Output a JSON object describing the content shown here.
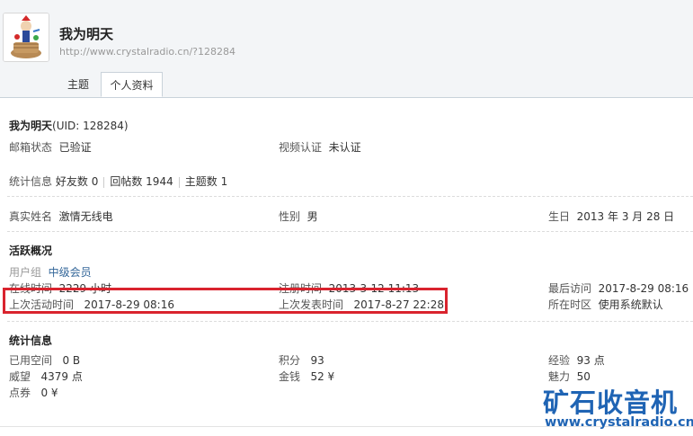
{
  "user": {
    "name": "我为明天",
    "url": "http://www.crystalradio.cn/?128284"
  },
  "tabs": [
    {
      "label": "主题",
      "active": false
    },
    {
      "label": "个人资料",
      "active": true
    }
  ],
  "profile": {
    "name": "我为明天",
    "uid_text": "(UID: 128284)",
    "email_status_label": "邮箱状态",
    "email_status_value": "已验证",
    "video_auth_label": "视频认证",
    "video_auth_value": "未认证",
    "stats_label": "统计信息",
    "friends_label": "好友数",
    "friends_value": "0",
    "replies_label": "回帖数",
    "replies_value": "1944",
    "topics_label": "主题数",
    "topics_value": "1",
    "realname_label": "真实姓名",
    "realname_value": "激情无线电",
    "gender_label": "性别",
    "gender_value": "男",
    "birthday_label": "生日",
    "birthday_value": "2013 年 3 月 28 日"
  },
  "activity": {
    "title": "活跃概况",
    "group_label": "用户组",
    "group_value": "中级会员",
    "online_label": "在线时间",
    "online_value": "2229 小时",
    "register_label": "注册时间",
    "register_value": "2013-3-12 11:13",
    "last_visit_label": "最后访问",
    "last_visit_value": "2017-8-29 08:16",
    "last_active_label": "上次活动时间",
    "last_active_value": "2017-8-29 08:16",
    "last_post_label": "上次发表时间",
    "last_post_value": "2017-8-27 22:28",
    "timezone_label": "所在时区",
    "timezone_value": "使用系统默认"
  },
  "statistics": {
    "title": "统计信息",
    "space_label": "已用空间",
    "space_value": "0 B",
    "points_label": "积分",
    "points_value": "93",
    "exp_label": "经验",
    "exp_value": "93 点",
    "prestige_label": "威望",
    "prestige_value": "4379 点",
    "money_label": "金钱",
    "money_value": "52 ¥",
    "charm_label": "魅力",
    "charm_value": "50",
    "coupons_label": "点券",
    "coupons_value": "0 ¥"
  },
  "watermark": {
    "title": "矿石收音机",
    "url": "www.crystalradio.cn"
  },
  "colors": {
    "highlight_border": "#d9232e",
    "watermark": "#1f64b4",
    "link_blue": "#336699",
    "header_bg": "#f3f5f7"
  }
}
